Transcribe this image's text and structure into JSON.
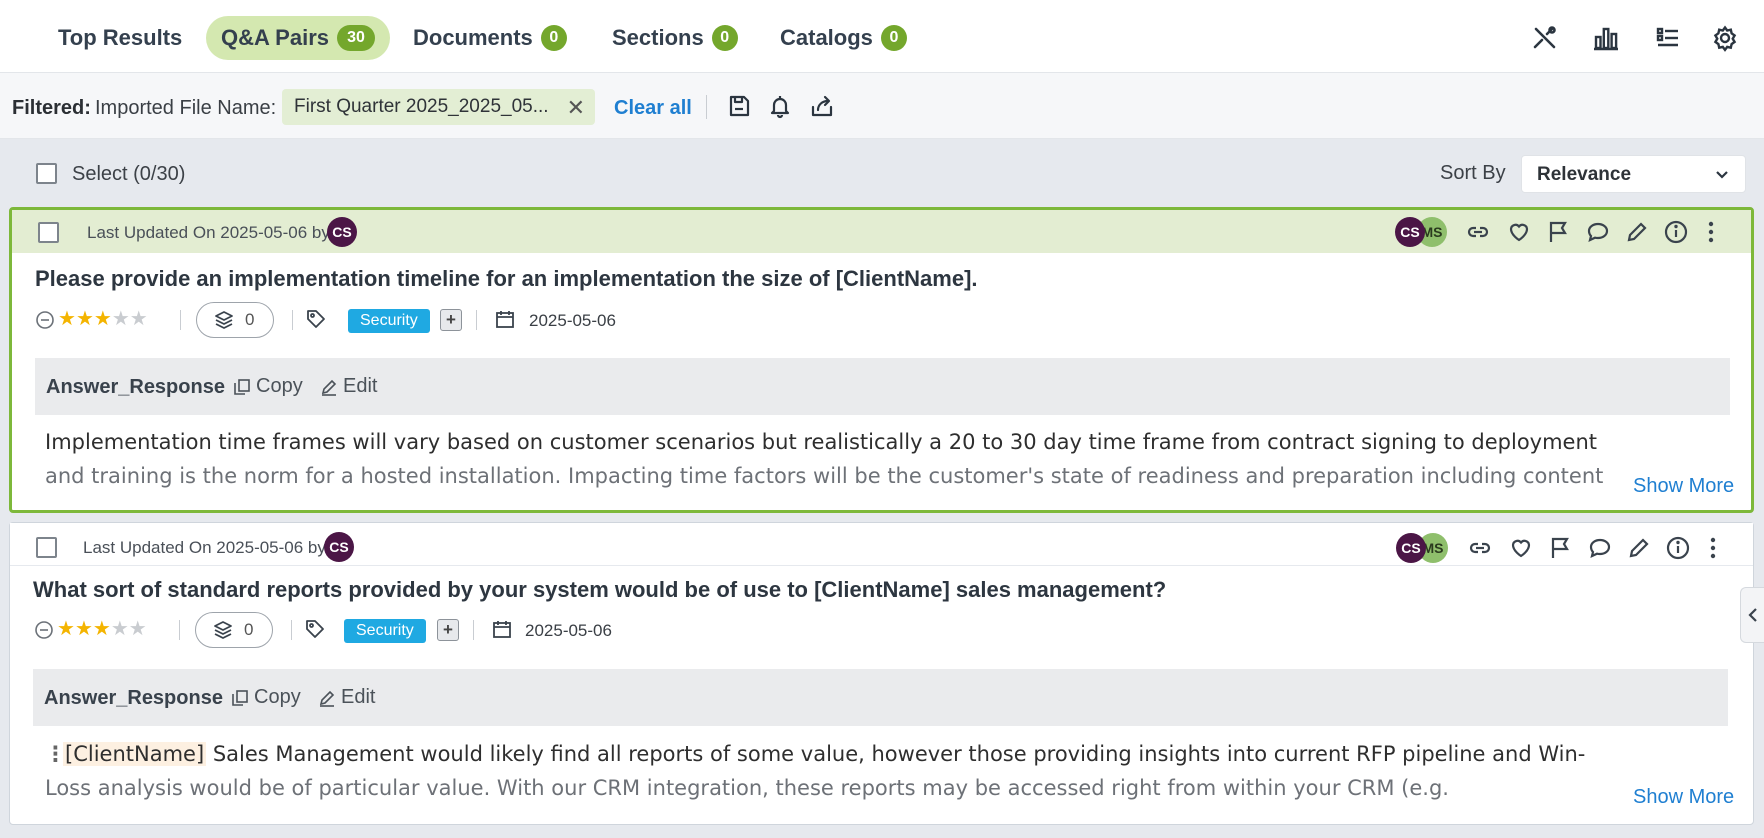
{
  "tabs": [
    {
      "label": "Top Results",
      "count": ""
    },
    {
      "label": "Q&A Pairs",
      "count": "30"
    },
    {
      "label": "Documents",
      "count": "0"
    },
    {
      "label": "Sections",
      "count": "0"
    },
    {
      "label": "Catalogs",
      "count": "0"
    }
  ],
  "toolbar_icons": [
    "tools-icon",
    "bar-chart-icon",
    "list-icon",
    "gear-icon"
  ],
  "filter": {
    "label": "Filtered:",
    "field": "Imported File Name:",
    "value": "First Quarter 2025_2025_05...",
    "clear_all": "Clear all"
  },
  "list": {
    "select_label": "Select (0/30)",
    "sort_label": "Sort By",
    "sort_value": "Relevance"
  },
  "cards": [
    {
      "updated": "Last Updated On 2025-05-06 by",
      "author_initials": "CS",
      "collaborators": [
        "CS",
        "MS"
      ],
      "question": "Please provide an implementation timeline for an implementation the size of [ClientName].",
      "rating": 3,
      "rating_max": 5,
      "stack_count": "0",
      "tag": "Security",
      "date": "2025-05-06",
      "answer_label": "Answer_Response",
      "copy_label": "Copy",
      "edit_label": "Edit",
      "answer_line1": "Implementation time frames will vary based on customer scenarios but realistically a 20 to 30 day time frame from contract signing to deployment",
      "answer_line2": "and training is the norm for a hosted installation. Impacting time factors will be the customer's state of readiness and preparation including content",
      "show_more": "Show More"
    },
    {
      "updated": "Last Updated On 2025-05-06 by",
      "author_initials": "CS",
      "collaborators": [
        "CS",
        "MS"
      ],
      "question": "What sort of standard reports provided by your system would be of use to [ClientName] sales management?",
      "rating": 3,
      "rating_max": 5,
      "stack_count": "0",
      "tag": "Security",
      "date": "2025-05-06",
      "answer_label": "Answer_Response",
      "copy_label": "Copy",
      "edit_label": "Edit",
      "answer_token": "[ClientName]",
      "answer_line1": " Sales Management would likely find all reports of some value, however those providing insights into current RFP pipeline and Win-",
      "answer_line2": "Loss analysis would be of particular value. With our CRM integration, these reports may be accessed right from within your CRM (e.g.",
      "show_more": "Show More"
    }
  ],
  "colors": {
    "accent_green": "#74a72c",
    "highlight_border": "#7db83a",
    "link_blue": "#1f7fd1",
    "tag_blue": "#1fa9e2",
    "star_gold": "#f4b400",
    "avatar_purple": "#4b1646"
  }
}
